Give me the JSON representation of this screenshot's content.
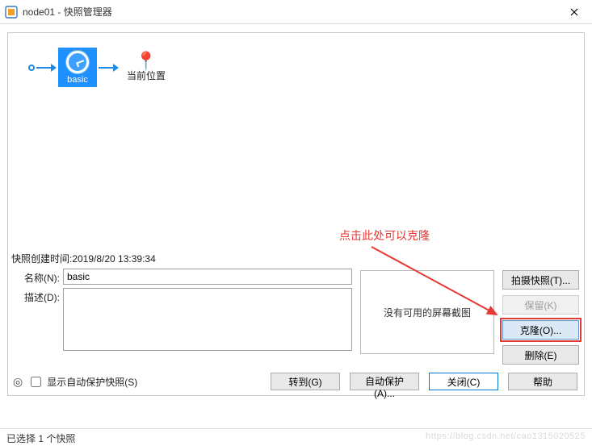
{
  "window": {
    "title": "node01 - 快照管理器",
    "close_glyph": "✕"
  },
  "tree": {
    "snapshot_label": "basic",
    "here_label": "当前位置"
  },
  "meta_time_label": "快照创建时间:2019/8/20 13:39:34",
  "form": {
    "name_label": "名称(N):",
    "name_value": "basic",
    "desc_label": "描述(D):",
    "desc_value": ""
  },
  "thumb_empty": "没有可用的屏幕截图",
  "buttons_right": {
    "take": "拍摄快照(T)...",
    "keep": "保留(K)",
    "clone": "克隆(O)...",
    "delete": "删除(E)"
  },
  "auto": {
    "checkbox_label": "显示自动保护快照(S)"
  },
  "bottom": {
    "goto": "转到(G)",
    "auto_protect": "自动保护(A)...",
    "close": "关闭(C)",
    "help": "帮助"
  },
  "annotation": "点击此处可以克隆",
  "status": "已选择 1 个快照",
  "watermark": "https://blog.csdn.net/cao1315020525"
}
